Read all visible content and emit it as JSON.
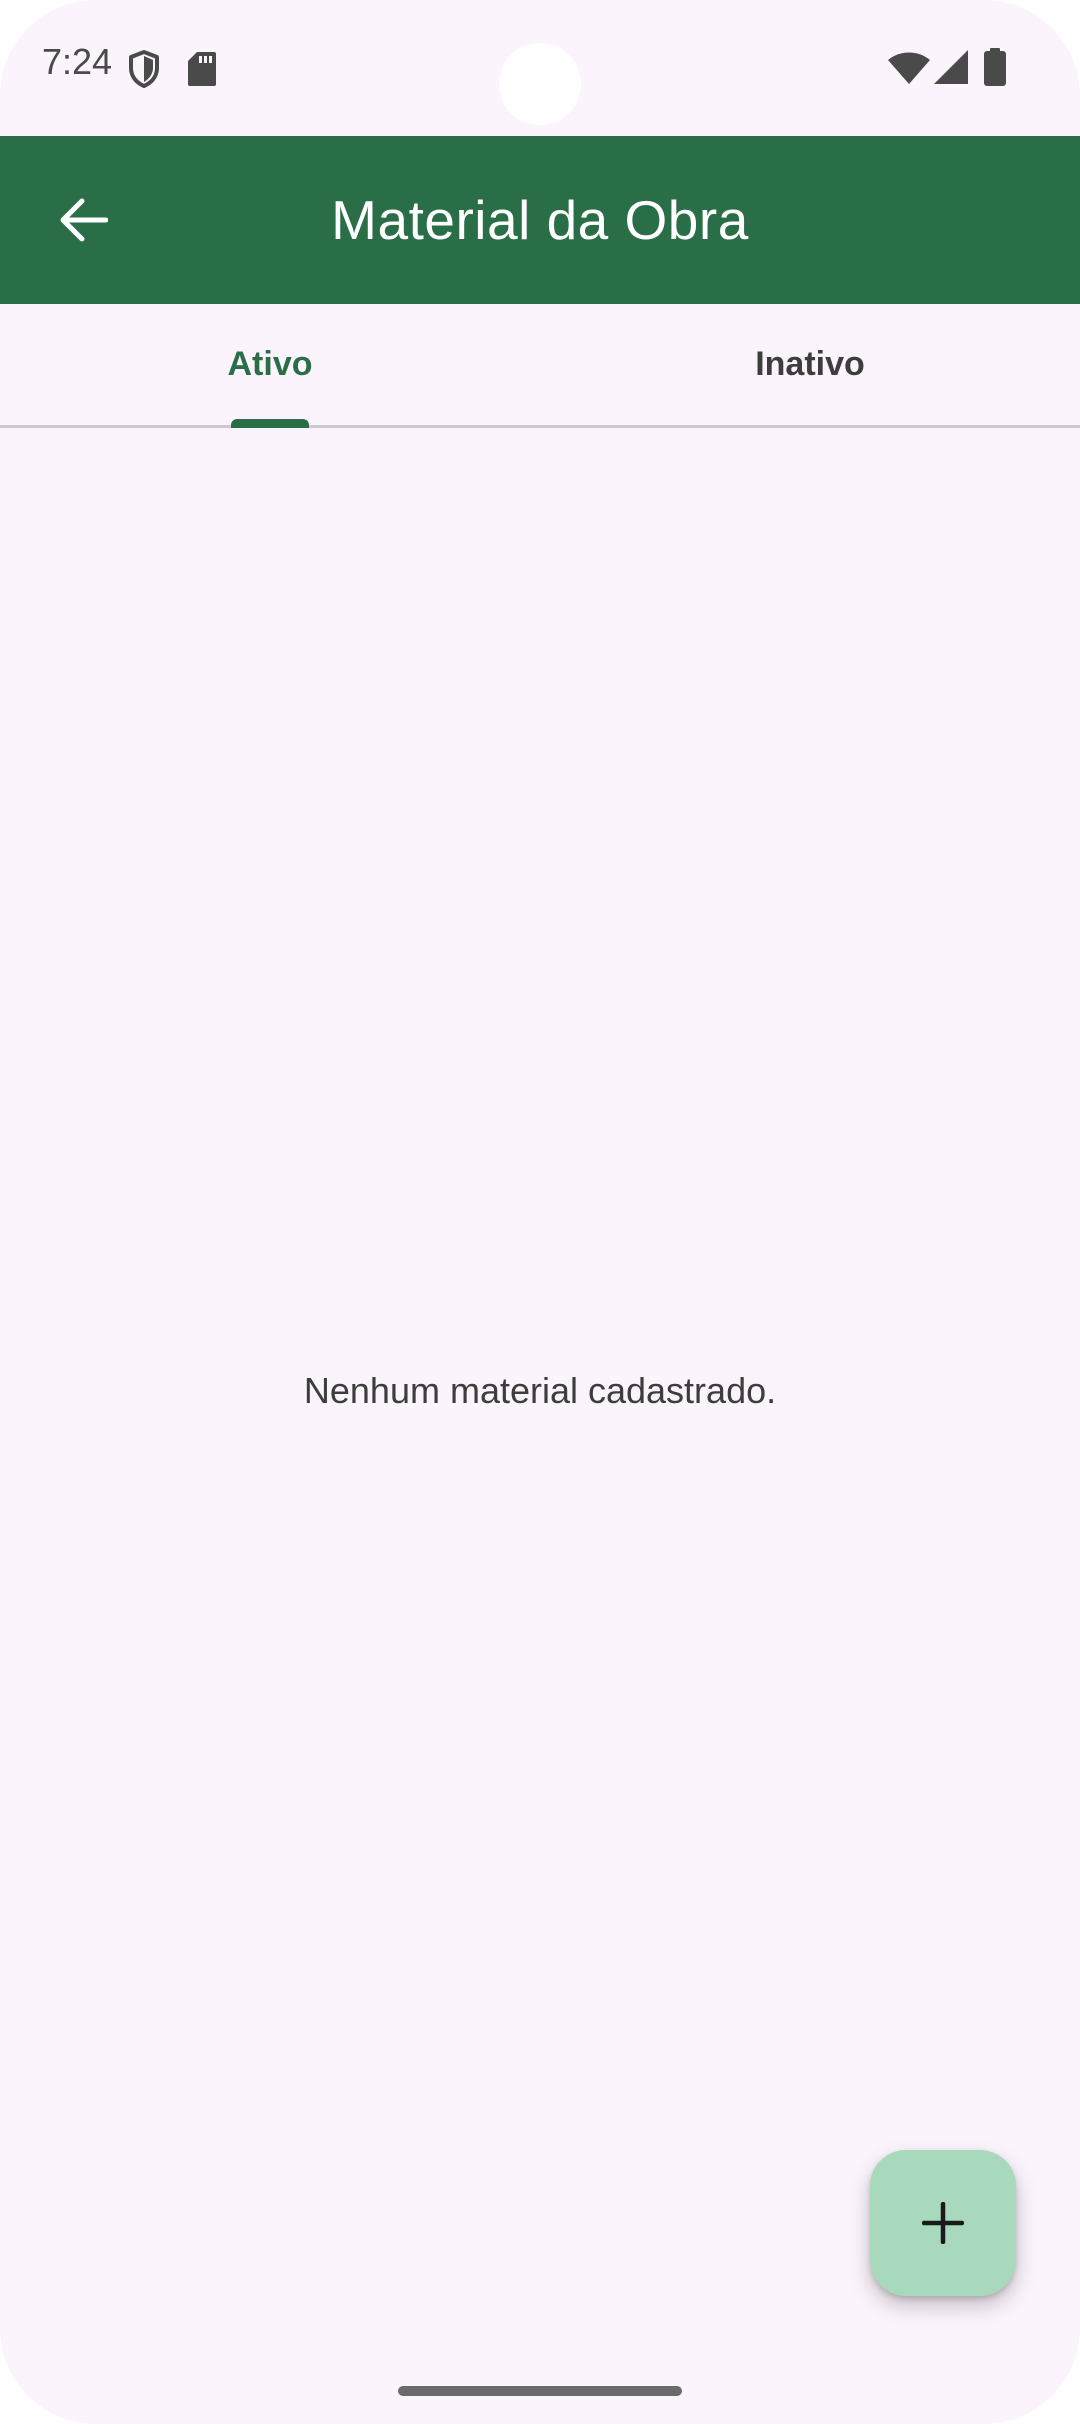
{
  "status_bar": {
    "time": "7:24",
    "icons_left": [
      "shield-icon",
      "sd-card-icon"
    ],
    "icons_right": [
      "wifi-icon",
      "cell-signal-icon",
      "battery-icon"
    ]
  },
  "app_bar": {
    "title": "Material da Obra",
    "back_icon": "arrow-back-icon",
    "background_color": "#2A6E48"
  },
  "tabs": [
    {
      "label": "Ativo",
      "selected": true
    },
    {
      "label": "Inativo",
      "selected": false
    }
  ],
  "content": {
    "empty_message": "Nenhum material cadastrado."
  },
  "fab": {
    "icon": "plus-icon",
    "color": "#A8D9BC"
  },
  "colors": {
    "accent": "#2A6E48",
    "background": "#FCF4FC"
  }
}
